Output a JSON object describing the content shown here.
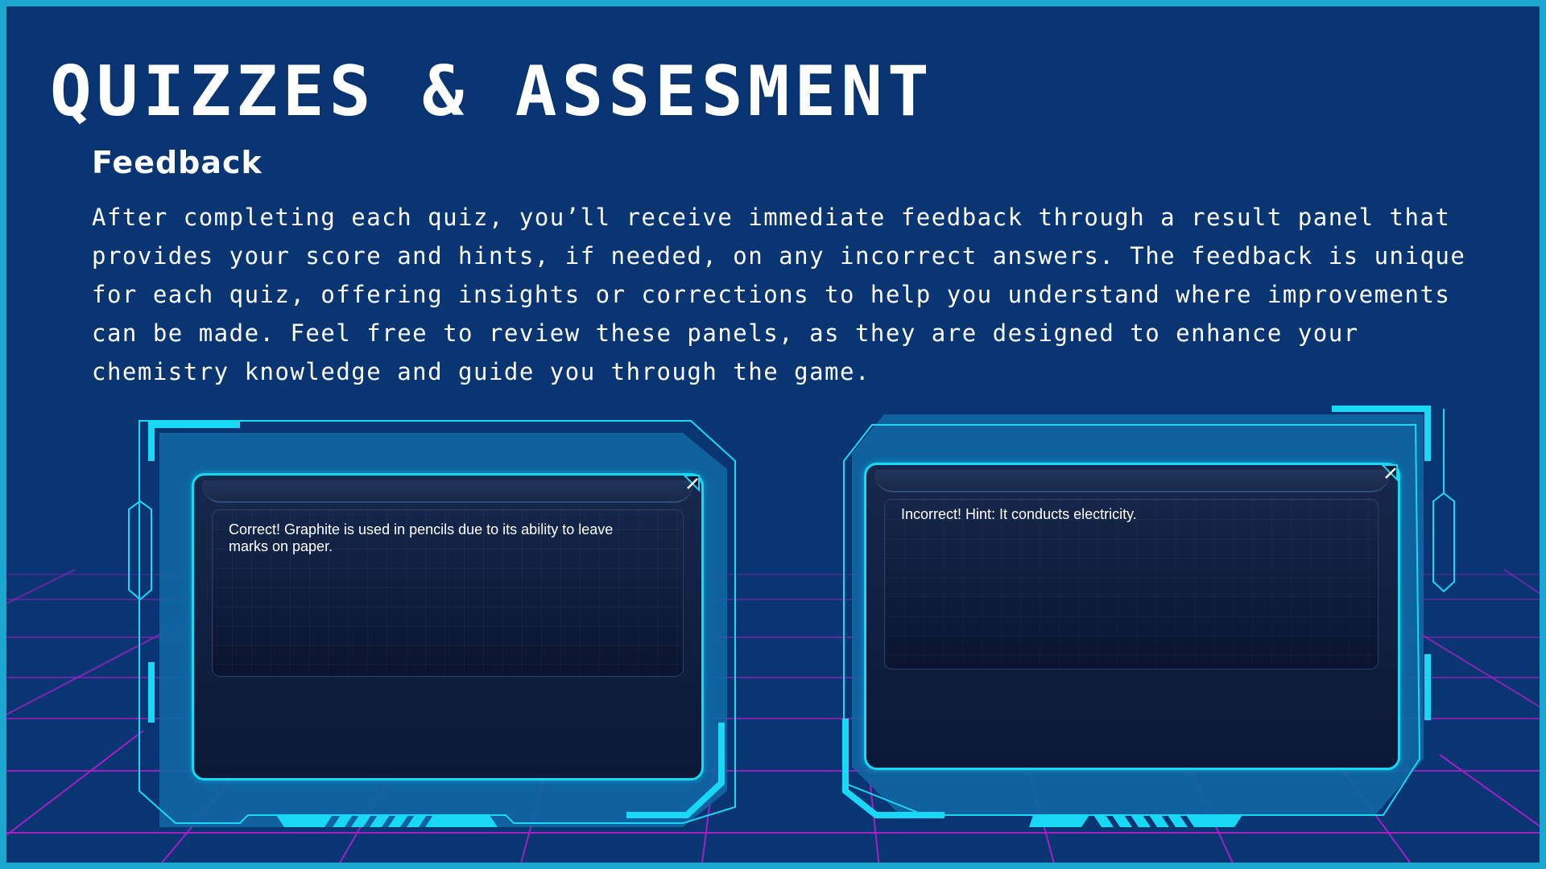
{
  "slide": {
    "title": "QUIZZES & ASSESMENT",
    "subtitle": "Feedback",
    "body": "After completing each quiz, you’ll receive immediate feedback through a result panel that provides your score and hints, if needed, on any incorrect answers. The feedback is unique for each quiz, offering insights or corrections to help you understand where improvements can be made. Feel free to review these panels, as they are designed to enhance your chemistry knowledge and guide you through the game."
  },
  "panels": [
    {
      "message": "Correct! Graphite is used in pencils due to its ability to leave marks on paper."
    },
    {
      "message": "Incorrect! Hint: It conducts electricity."
    }
  ],
  "colors": {
    "background": "#0a3573",
    "border": "#1aa6cf",
    "frame_cyan": "#19d8f3",
    "grid_magenta": "#c21fd6"
  },
  "icons": {
    "panel_corner": "expand-icon"
  }
}
